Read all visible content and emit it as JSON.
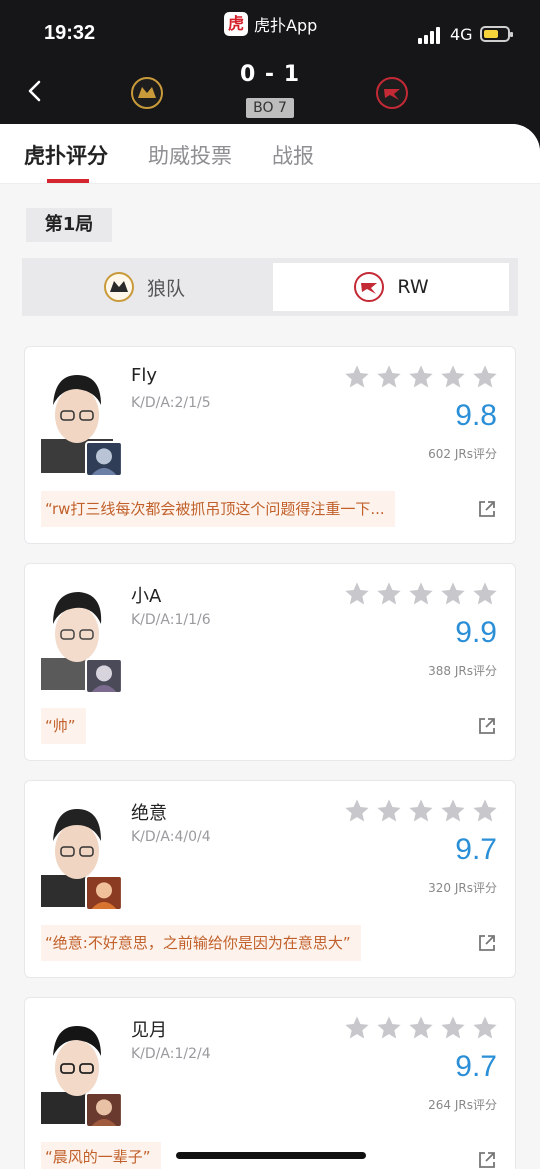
{
  "status_bar": {
    "time": "19:32",
    "app_name": "虎扑App",
    "network": "4G"
  },
  "match": {
    "score": "0 - 1",
    "format": "BO 7"
  },
  "tabs": [
    {
      "label": "虎扑评分"
    },
    {
      "label": "助威投票"
    },
    {
      "label": "战报"
    }
  ],
  "game": {
    "label": "第1局"
  },
  "teams": {
    "left": "狼队",
    "right": "RW"
  },
  "players": [
    {
      "name": "Fly",
      "kda": "K/D/A:2/1/5",
      "rating": "9.8",
      "votes": "602 JRs评分",
      "comment": "“rw打三线每次都会被抓吊顶这个问题得注重一下..."
    },
    {
      "name": "小A",
      "kda": "K/D/A:1/1/6",
      "rating": "9.9",
      "votes": "388 JRs评分",
      "comment": "“帅”"
    },
    {
      "name": "绝意",
      "kda": "K/D/A:4/0/4",
      "rating": "9.7",
      "votes": "320 JRs评分",
      "comment": "“绝意:不好意思，之前输给你是因为在意思大”"
    },
    {
      "name": "见月",
      "kda": "K/D/A:1/2/4",
      "rating": "9.7",
      "votes": "264 JRs评分",
      "comment": "“晨风的一辈子”"
    }
  ],
  "colors": {
    "accent": "#d5252f",
    "rating": "#2b8fd7",
    "comment_text": "#c1602a"
  }
}
